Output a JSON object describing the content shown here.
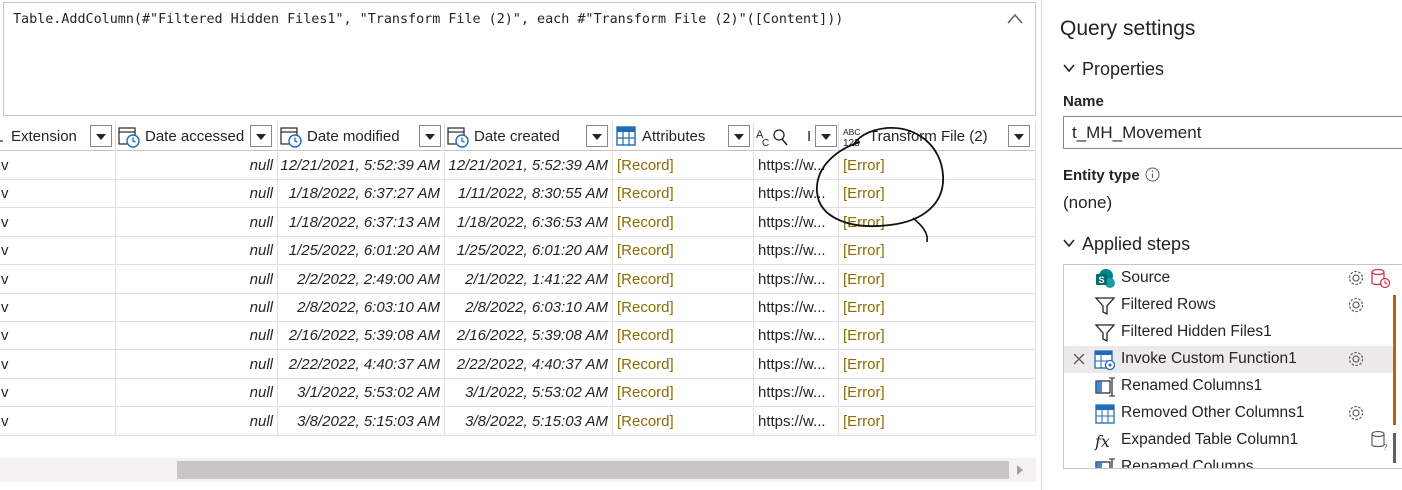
{
  "formula": {
    "text": "Table.AddColumn(#\"Filtered Hidden Files1\", \"Transform File (2)\", each #\"Transform File (2)\"([Content]))",
    "collapse_icon": "chevron-up-icon"
  },
  "grid": {
    "columns": [
      {
        "label": "Extension",
        "type_icon": "text-type-icon"
      },
      {
        "label": "Date accessed",
        "type_icon": "datetime-type-icon"
      },
      {
        "label": "Date modified",
        "type_icon": "datetime-type-icon"
      },
      {
        "label": "Date created",
        "type_icon": "datetime-type-icon"
      },
      {
        "label": "Attributes",
        "type_icon": "table-type-icon"
      },
      {
        "label": "I",
        "type_icon": "any-type-icon"
      },
      {
        "label": "Transform File (2)",
        "type_icon": "any-type-icon"
      }
    ],
    "rows": [
      {
        "ext": "v",
        "accessed": "null",
        "modified": "12/21/2021, 5:52:39 AM",
        "created": "12/21/2021, 5:52:39 AM",
        "attr": "[Record]",
        "url": "https://w...",
        "tf": "[Error]"
      },
      {
        "ext": "v",
        "accessed": "null",
        "modified": "1/18/2022, 6:37:27 AM",
        "created": "1/11/2022, 8:30:55 AM",
        "attr": "[Record]",
        "url": "https://w...",
        "tf": "[Error]"
      },
      {
        "ext": "v",
        "accessed": "null",
        "modified": "1/18/2022, 6:37:13 AM",
        "created": "1/18/2022, 6:36:53 AM",
        "attr": "[Record]",
        "url": "https://w...",
        "tf": "[Error]"
      },
      {
        "ext": "v",
        "accessed": "null",
        "modified": "1/25/2022, 6:01:20 AM",
        "created": "1/25/2022, 6:01:20 AM",
        "attr": "[Record]",
        "url": "https://w...",
        "tf": "[Error]"
      },
      {
        "ext": "v",
        "accessed": "null",
        "modified": "2/2/2022, 2:49:00 AM",
        "created": "2/1/2022, 1:41:22 AM",
        "attr": "[Record]",
        "url": "https://w...",
        "tf": "[Error]"
      },
      {
        "ext": "v",
        "accessed": "null",
        "modified": "2/8/2022, 6:03:10 AM",
        "created": "2/8/2022, 6:03:10 AM",
        "attr": "[Record]",
        "url": "https://w...",
        "tf": "[Error]"
      },
      {
        "ext": "v",
        "accessed": "null",
        "modified": "2/16/2022, 5:39:08 AM",
        "created": "2/16/2022, 5:39:08 AM",
        "attr": "[Record]",
        "url": "https://w...",
        "tf": "[Error]"
      },
      {
        "ext": "v",
        "accessed": "null",
        "modified": "2/22/2022, 4:40:37 AM",
        "created": "2/22/2022, 4:40:37 AM",
        "attr": "[Record]",
        "url": "https://w...",
        "tf": "[Error]"
      },
      {
        "ext": "v",
        "accessed": "null",
        "modified": "3/1/2022, 5:53:02 AM",
        "created": "3/1/2022, 5:53:02 AM",
        "attr": "[Record]",
        "url": "https://w...",
        "tf": "[Error]"
      },
      {
        "ext": "v",
        "accessed": "null",
        "modified": "3/8/2022, 5:15:03 AM",
        "created": "3/8/2022, 5:15:03 AM",
        "attr": "[Record]",
        "url": "https://w...",
        "tf": "[Error]"
      }
    ],
    "colors": {
      "record": "#8a6d00",
      "error": "#8a6d00"
    }
  },
  "pane": {
    "title": "Query settings",
    "properties_header": "Properties",
    "name_label": "Name",
    "name_value": "t_MH_Movement",
    "entity_label": "Entity type",
    "entity_value": "(none)",
    "applied_header": "Applied steps",
    "steps": [
      {
        "label": "Source",
        "icon": "sharepoint-icon",
        "gear": true,
        "extra": "database-warning-icon"
      },
      {
        "label": "Filtered Rows",
        "icon": "filter-icon",
        "gear": true
      },
      {
        "label": "Filtered Hidden Files1",
        "icon": "filter-icon",
        "gear": false
      },
      {
        "label": "Invoke Custom Function1",
        "icon": "table-function-icon",
        "gear": true,
        "selected": true
      },
      {
        "label": "Renamed Columns1",
        "icon": "rename-columns-icon",
        "gear": false
      },
      {
        "label": "Removed Other Columns1",
        "icon": "table-icon",
        "gear": true
      },
      {
        "label": "Expanded Table Column1",
        "icon": "fx-icon",
        "gear": false,
        "extra": "database-query-icon"
      },
      {
        "label": "Renamed Columns",
        "icon": "rename-columns-icon",
        "gear": false
      }
    ]
  }
}
